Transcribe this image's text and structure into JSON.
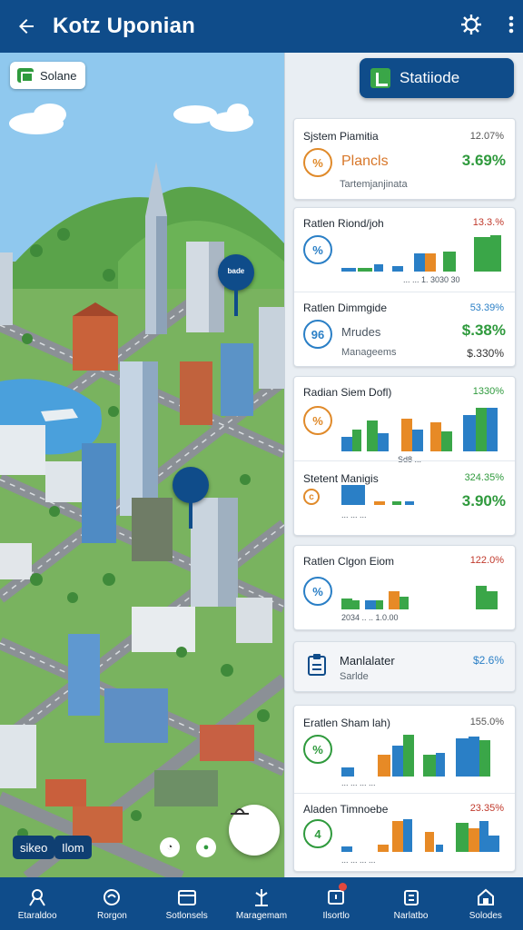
{
  "header": {
    "title": "Kotz Uponian"
  },
  "map": {
    "solar_chip": "Solane",
    "pins": [
      "ᵇᵃᵈᵉ",
      ""
    ],
    "tags": [
      "sikeo",
      "Ilom"
    ]
  },
  "panel": {
    "stat_button": "Statiiode",
    "cards": [
      {
        "sections": [
          {
            "title": "Sjstem Piamitia",
            "pct": "12.07%",
            "icon": "%",
            "sub": "Plancls",
            "big": "3.69%",
            "sub2": "Tartemjanjinata"
          }
        ]
      },
      {
        "sections": [
          {
            "title": "Ratlen Riond/joh",
            "pct": "13.3.%",
            "icon": "%",
            "ticks": "... ... 1. 3030 30"
          },
          {
            "title": "Ratlen Dimmgide",
            "pct": "53.39%",
            "icon": "96",
            "sub": "Mrudes",
            "big": "$.38%",
            "sub2": "Manageems",
            "big2": "$.330%"
          }
        ]
      },
      {
        "sections": [
          {
            "title": "Radian Siem Dofl)",
            "pct": "1330%",
            "icon": "%",
            "ticks": "Sd8 ..."
          },
          {
            "title": "Stetent Manigis",
            "pct": "324.35%",
            "icon": "c",
            "big": "3.90%",
            "ticks": "... ... ..."
          }
        ]
      },
      {
        "sections": [
          {
            "title": "Ratlen Clgon Eiom",
            "pct": "122.0%",
            "icon": "%",
            "ticks": "2034  ..  ..   1.0.00"
          }
        ]
      },
      {
        "sections": [
          {
            "title": "Manlalater",
            "pct": "$2.6%",
            "sub2": "Sarlde"
          }
        ]
      },
      {
        "sections": [
          {
            "title": "Eratlen Sham lah)",
            "pct": "155.0%",
            "icon": "%",
            "ticks": "... ... ... ..."
          },
          {
            "title": "Aladen Timnoebe",
            "pct": "23.35%",
            "icon": "4",
            "ticks": "... ... ... ..."
          }
        ]
      }
    ]
  },
  "bottom_nav": [
    {
      "label": "Etaraldoo",
      "icon": "person-pin-icon"
    },
    {
      "label": "Rorgon",
      "icon": "swap-icon"
    },
    {
      "label": "Sotlonsels",
      "icon": "calendar-icon"
    },
    {
      "label": "Maragemam",
      "icon": "pin-flag-icon"
    },
    {
      "label": "Ilsortlo",
      "icon": "alert-icon"
    },
    {
      "label": "Narlatbo",
      "icon": "building-icon"
    },
    {
      "label": "Solodes",
      "icon": "garage-icon"
    }
  ],
  "colors": {
    "primary": "#0f4c8a",
    "green": "#3aa648",
    "orange": "#e78a26",
    "blue": "#2a7fc6"
  }
}
